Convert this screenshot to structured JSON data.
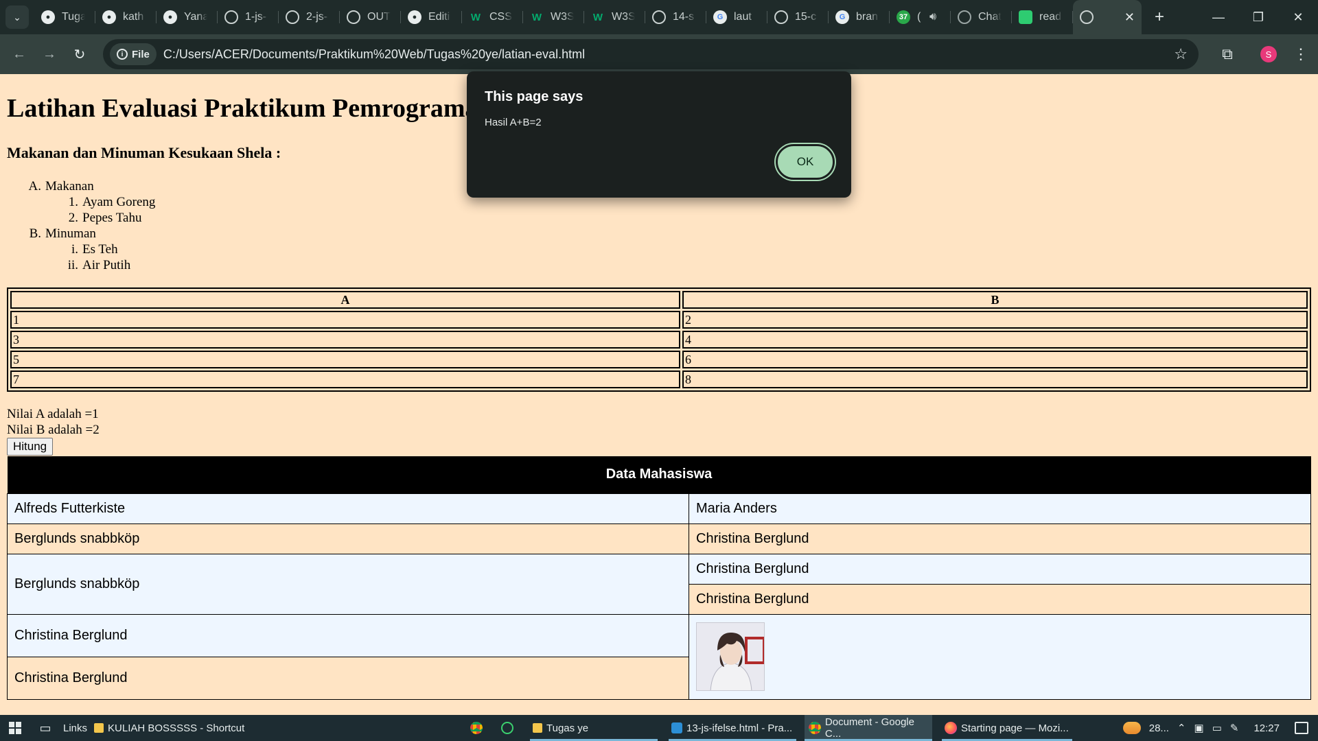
{
  "browser": {
    "tabs": [
      {
        "title": "Tugas",
        "icon": "github-icon"
      },
      {
        "title": "kath",
        "icon": "github-icon"
      },
      {
        "title": "Yana",
        "icon": "github-icon"
      },
      {
        "title": "1-js-",
        "icon": "globe-icon"
      },
      {
        "title": "2-js-",
        "icon": "globe-icon"
      },
      {
        "title": "OUT",
        "icon": "globe-icon"
      },
      {
        "title": "Editi",
        "icon": "github-icon"
      },
      {
        "title": "CSS",
        "icon": "w3schools-icon"
      },
      {
        "title": "W3S",
        "icon": "w3schools-icon"
      },
      {
        "title": "W3S",
        "icon": "w3schools-icon"
      },
      {
        "title": "14-s",
        "icon": "globe-icon"
      },
      {
        "title": "laut",
        "icon": "google-icon"
      },
      {
        "title": "15-c",
        "icon": "globe-icon"
      },
      {
        "title": "bran",
        "icon": "google-icon"
      },
      {
        "title": "(",
        "icon": "whatsapp-icon",
        "badge": "37"
      },
      {
        "title": "Chat",
        "icon": "chatgpt-icon"
      },
      {
        "title": "read",
        "icon": "readme-icon"
      }
    ],
    "active_tab_close": "✕",
    "site_chip": "File",
    "url": "C:/Users/ACER/Documents/Praktikum%20Web/Tugas%20ye/latian-eval.html",
    "profile_initial": "S"
  },
  "page": {
    "heading": "Latihan Evaluasi Praktikum Pemrograman Web",
    "subheading": "Makanan dan Minuman Kesukaan Shela :",
    "list": [
      {
        "marker": "A.",
        "label": "Makanan",
        "children": [
          {
            "marker": "1.",
            "label": "Ayam Goreng"
          },
          {
            "marker": "2.",
            "label": "Pepes Tahu"
          }
        ]
      },
      {
        "marker": "B.",
        "label": "Minuman",
        "children": [
          {
            "marker": "i.",
            "label": "Es Teh"
          },
          {
            "marker": "ii.",
            "label": "Air Putih"
          }
        ]
      }
    ],
    "ab_table": {
      "headers": [
        "A",
        "B"
      ],
      "rows": [
        [
          "1",
          "2"
        ],
        [
          "3",
          "4"
        ],
        [
          "5",
          "6"
        ],
        [
          "7",
          "8"
        ]
      ]
    },
    "nilai_a": "Nilai A adalah =1",
    "nilai_b": "Nilai B adalah =2",
    "hitung_button": "Hitung",
    "mahasiswa": {
      "title": "Data Mahasiswa",
      "row1": [
        "Alfreds Futterkiste",
        "Maria Anders"
      ],
      "row2": [
        "Berglunds snabbköp",
        "Christina Berglund"
      ],
      "row3_left": "Berglunds snabbköp",
      "row3_right_a": "Christina Berglund",
      "row4_right_b": "Christina Berglund",
      "row5_left": "Christina Berglund",
      "row6_left": "Christina Berglund"
    }
  },
  "dialog": {
    "title": "This page says",
    "message": "Hasil A+B=2",
    "ok_label": "OK"
  },
  "taskbar": {
    "links_label": "Links",
    "shortcut_label": "KULIAH BOSSSSS - Shortcut",
    "apps": [
      {
        "label": "Tugas ye"
      },
      {
        "label": "13-js-ifelse.html - Pra..."
      },
      {
        "label": "Document - Google C..."
      },
      {
        "label": "Starting page — Mozi..."
      }
    ],
    "weather": "28...",
    "time": "12:27"
  }
}
